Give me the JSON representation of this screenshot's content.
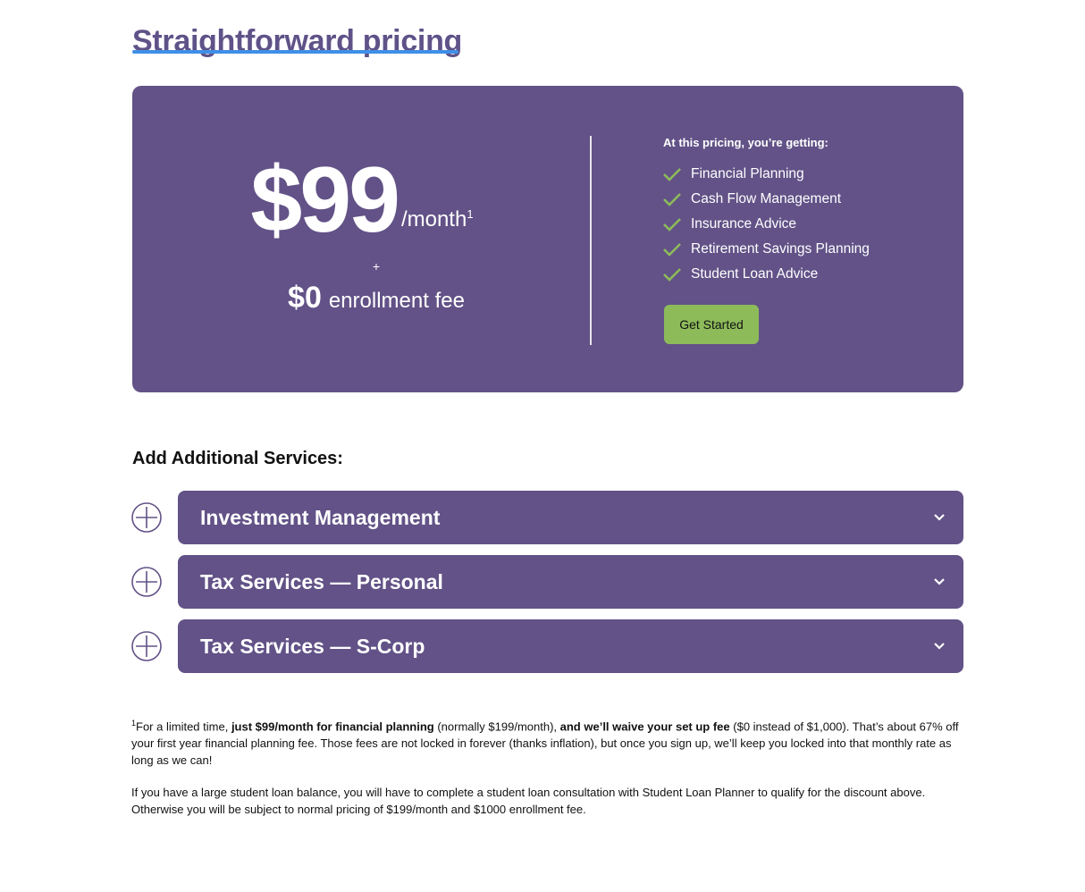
{
  "heading": "Straightforward pricing",
  "pricing_card": {
    "price": "$99",
    "period": "/month",
    "period_sup": "1",
    "plus": "+",
    "enroll_amount": "$0",
    "enroll_label": "enrollment fee",
    "features_title": "At this pricing, you’re getting:",
    "features": [
      "Financial Planning",
      "Cash Flow Management",
      "Insurance Advice",
      "Retirement Savings Planning",
      "Student Loan Advice"
    ],
    "cta_label": "Get Started"
  },
  "additional": {
    "title": "Add Additional Services:",
    "services": [
      {
        "label": "Investment Management",
        "icon": "plus-circle-icon"
      },
      {
        "label": "Tax Services — Personal",
        "icon": "plus-circle-icon"
      },
      {
        "label": "Tax Services — S-Corp",
        "icon": "plus-circle-icon"
      }
    ]
  },
  "footnotes": {
    "fn1_sup": "1",
    "fn1_a": "For a limited time, ",
    "fn1_b": "just $99/month for financial planning",
    "fn1_c": " (normally $199/month), ",
    "fn1_d": "and we’ll waive your set up fee",
    "fn1_e": " ($0 instead of $1,000). That’s about 67% off your first year financial planning fee. Those fees are not locked in forever (thanks inflation), but once you sign up, we’ll keep you locked into that monthly rate as long as we can!",
    "fn2": "If you have a large student loan balance, you will have to complete a student loan consultation with Student Loan Planner to qualify for the discount above. Otherwise you will be subject to normal pricing of $199/month and $1000 enrollment fee."
  },
  "colors": {
    "brand_purple": "#625287",
    "heading_purple": "#5f5288",
    "accent_green": "#8dbb5a",
    "underline_blue": "#3f8fe6"
  }
}
